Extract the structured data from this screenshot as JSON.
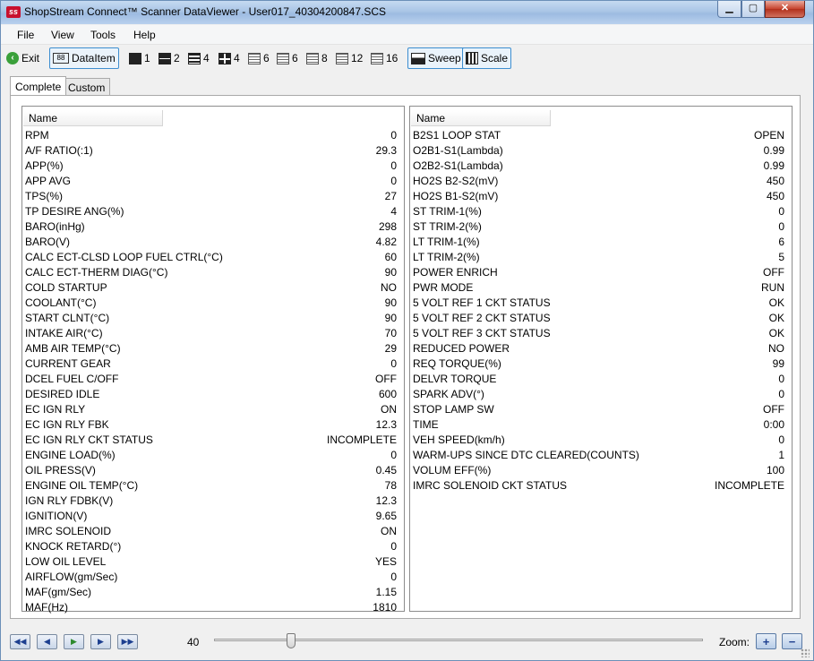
{
  "window": {
    "title": "ShopStream Connect™ Scanner DataViewer - User017_40304200847.SCS",
    "app_icon_text": "ss",
    "minimize_icon": "minimize-icon",
    "maximize_icon": "maximize-icon",
    "close_icon": "close-icon"
  },
  "menu": [
    "File",
    "View",
    "Tools",
    "Help"
  ],
  "toolbar": {
    "exit_label": "Exit",
    "dataitem_label": "DataItem",
    "dataitem_icon_text": "88",
    "layouts": [
      "1",
      "2",
      "4",
      "4",
      "6",
      "6",
      "8",
      "12",
      "16"
    ],
    "sweep_label": "Sweep",
    "scale_label": "Scale"
  },
  "tabs": [
    "Complete",
    "Custom"
  ],
  "left_panel": {
    "header": "Name",
    "rows": [
      {
        "name": "RPM",
        "value": "0"
      },
      {
        "name": "A/F RATIO(:1)",
        "value": "29.3"
      },
      {
        "name": "APP(%)",
        "value": "0"
      },
      {
        "name": "APP AVG",
        "value": "0"
      },
      {
        "name": "TPS(%)",
        "value": "27"
      },
      {
        "name": "TP DESIRE ANG(%)",
        "value": "4"
      },
      {
        "name": "BARO(inHg)",
        "value": "298"
      },
      {
        "name": "BARO(V)",
        "value": "4.82"
      },
      {
        "name": "CALC ECT-CLSD LOOP FUEL CTRL(°C)",
        "value": "60"
      },
      {
        "name": "CALC ECT-THERM DIAG(°C)",
        "value": "90"
      },
      {
        "name": "COLD STARTUP",
        "value": "NO"
      },
      {
        "name": "COOLANT(°C)",
        "value": "90"
      },
      {
        "name": "START CLNT(°C)",
        "value": "90"
      },
      {
        "name": "INTAKE AIR(°C)",
        "value": "70"
      },
      {
        "name": "AMB AIR TEMP(°C)",
        "value": "29"
      },
      {
        "name": "CURRENT GEAR",
        "value": "0"
      },
      {
        "name": "DCEL FUEL C/OFF",
        "value": "OFF"
      },
      {
        "name": "DESIRED IDLE",
        "value": "600"
      },
      {
        "name": "EC IGN RLY",
        "value": "ON"
      },
      {
        "name": "EC IGN RLY FBK",
        "value": "12.3"
      },
      {
        "name": "EC IGN RLY CKT STATUS",
        "value": "INCOMPLETE"
      },
      {
        "name": "ENGINE LOAD(%)",
        "value": "0"
      },
      {
        "name": "OIL PRESS(V)",
        "value": "0.45"
      },
      {
        "name": "ENGINE OIL TEMP(°C)",
        "value": "78"
      },
      {
        "name": "IGN RLY FDBK(V)",
        "value": "12.3"
      },
      {
        "name": "IGNITION(V)",
        "value": "9.65"
      },
      {
        "name": "IMRC SOLENOID",
        "value": "ON"
      },
      {
        "name": "KNOCK RETARD(°)",
        "value": "0"
      },
      {
        "name": "LOW OIL LEVEL",
        "value": "YES"
      },
      {
        "name": "AIRFLOW(gm/Sec)",
        "value": "0"
      },
      {
        "name": "MAF(gm/Sec)",
        "value": "1.15"
      },
      {
        "name": "MAF(Hz)",
        "value": "1810"
      }
    ]
  },
  "right_panel": {
    "header": "Name",
    "rows": [
      {
        "name": "B2S1 LOOP STAT",
        "value": "OPEN"
      },
      {
        "name": "O2B1-S1(Lambda)",
        "value": "0.99"
      },
      {
        "name": "O2B2-S1(Lambda)",
        "value": "0.99"
      },
      {
        "name": "HO2S B2-S2(mV)",
        "value": "450"
      },
      {
        "name": "HO2S B1-S2(mV)",
        "value": "450"
      },
      {
        "name": "ST TRIM-1(%)",
        "value": "0"
      },
      {
        "name": "ST TRIM-2(%)",
        "value": "0"
      },
      {
        "name": "LT TRIM-1(%)",
        "value": "6"
      },
      {
        "name": "LT TRIM-2(%)",
        "value": "5"
      },
      {
        "name": "POWER ENRICH",
        "value": "OFF"
      },
      {
        "name": "PWR MODE",
        "value": "RUN"
      },
      {
        "name": "5 VOLT REF 1 CKT STATUS",
        "value": "OK"
      },
      {
        "name": "5 VOLT REF 2 CKT STATUS",
        "value": "OK"
      },
      {
        "name": "5 VOLT REF 3 CKT STATUS",
        "value": "OK"
      },
      {
        "name": "REDUCED POWER",
        "value": "NO"
      },
      {
        "name": "REQ TORQUE(%)",
        "value": "99"
      },
      {
        "name": "DELVR TORQUE",
        "value": "0"
      },
      {
        "name": "SPARK ADV(°)",
        "value": "0"
      },
      {
        "name": "STOP LAMP SW",
        "value": "OFF"
      },
      {
        "name": "TIME",
        "value": "0:00"
      },
      {
        "name": "VEH SPEED(km/h)",
        "value": "0"
      },
      {
        "name": "WARM-UPS SINCE DTC CLEARED(COUNTS)",
        "value": "1"
      },
      {
        "name": "VOLUM EFF(%)",
        "value": "100"
      },
      {
        "name": "IMRC SOLENOID CKT STATUS",
        "value": "INCOMPLETE"
      }
    ]
  },
  "playback": {
    "position": "40",
    "position_fraction": 0.15,
    "zoom_label": "Zoom:",
    "zoom_in_icon": "zoom-in-icon",
    "zoom_out_icon": "zoom-out-icon"
  }
}
